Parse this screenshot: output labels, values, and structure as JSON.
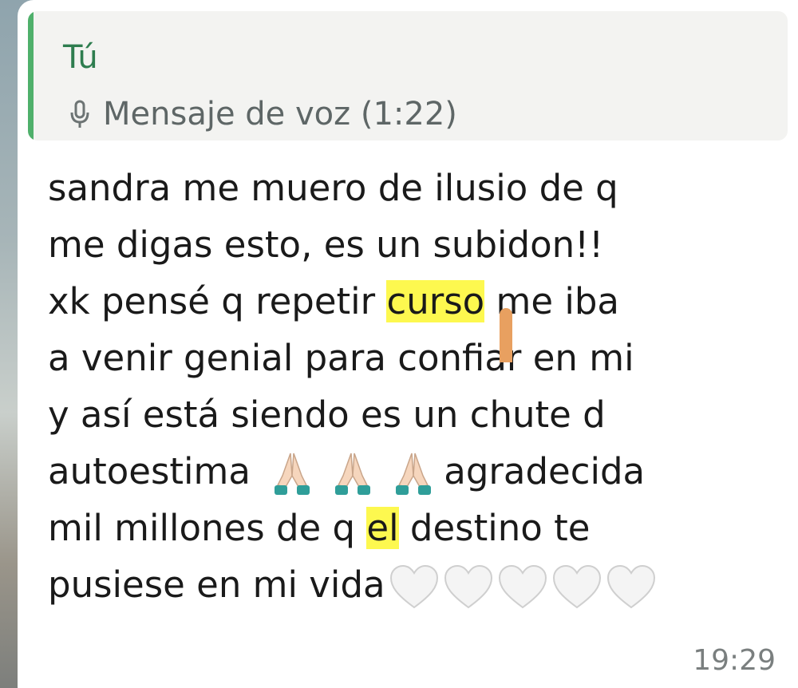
{
  "quote": {
    "author": "Tú",
    "text": "Mensaje de voz (1:22)",
    "icon": "microphone-icon"
  },
  "message": {
    "line1": "sandra me muero de ilusio  de q",
    "line2": "me digas esto, es un subidon!!",
    "line3_a": "xk pensé q repetir ",
    "line3_hl": "curso",
    "line3_b": " me iba",
    "line4": "a venir genial para confiar en mi",
    "line5": "y así está siendo  es un chute d",
    "line6_a": "autoestima ",
    "line6_b": "agradecida",
    "line7_a": "mil millones de q ",
    "line7_hl": "el",
    "line7_b": " destino te",
    "line8": "pusiese en mi vida",
    "emojis": [
      "folded-hands",
      "folded-hands",
      "folded-hands",
      "white-heart",
      "white-heart",
      "white-heart",
      "white-heart",
      "white-heart"
    ],
    "time": "19:29"
  },
  "colors": {
    "quote_bar": "#4fb06b",
    "quote_author": "#2e7d4f",
    "highlight": "#fdf84f",
    "selection_handle": "#e8a060"
  }
}
